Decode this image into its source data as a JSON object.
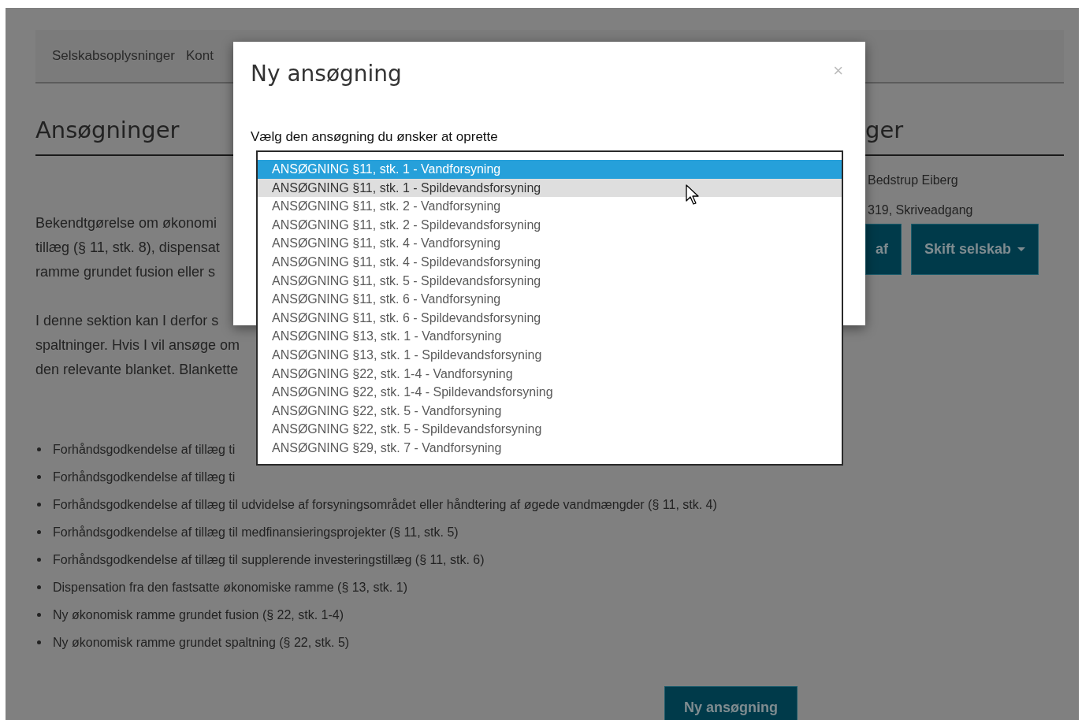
{
  "nav": {
    "items": [
      {
        "label": "Selskabsoplysninger"
      },
      {
        "label": "Kont"
      }
    ]
  },
  "main": {
    "heading": "Ansøgninger",
    "paragraphs": [
      [
        "Bekendtgørelse om økonomi",
        "tillæg (§ 11, stk. 8), dispensat",
        "ramme grundet fusion eller s"
      ],
      [
        "I denne sektion kan I derfor s",
        "spaltninger. Hvis I vil ansøge om",
        "den relevante blanket. Blankette"
      ]
    ],
    "bullets": [
      "Forhåndsgodkendelse af tillæg ti",
      "Forhåndsgodkendelse af tillæg ti",
      "Forhåndsgodkendelse af tillæg til udvidelse af forsyningsområdet eller håndtering af øgede vandmængder (§ 11, stk. 4)",
      "Forhåndsgodkendelse af tillæg til medfinansieringsprojekter (§ 11, stk. 5)",
      "Forhåndsgodkendelse af tillæg til supplerende investeringstillæg (§ 11, stk. 6)",
      "Dispensation fra den fastsatte økonomiske ramme (§ 13, stk. 1)",
      "Ny økonomisk ramme grundet fusion (§ 22, stk. 1-4)",
      "Ny økonomisk ramme grundet spaltning (§ 22, stk. 5)"
    ],
    "button": "Ny ansøgning"
  },
  "side": {
    "heading": "ger",
    "lines": [
      "Bedstrup Eiberg",
      "319, Skriveadgang"
    ],
    "buttons": [
      {
        "label": "af",
        "caret": false
      },
      {
        "label": "Skift selskab",
        "caret": true
      }
    ]
  },
  "modal": {
    "title": "Ny ansøgning",
    "close": "×",
    "label": "Vælg den ansøgning du ønsker at oprette",
    "options": [
      {
        "label": "ANSØGNING §11, stk. 1 - Vandforsyning",
        "selected": true,
        "hovered": false
      },
      {
        "label": "ANSØGNING §11, stk. 1 - Spildevandsforsyning",
        "selected": false,
        "hovered": true
      },
      {
        "label": "ANSØGNING §11, stk. 2 - Vandforsyning",
        "selected": false,
        "hovered": false
      },
      {
        "label": "ANSØGNING §11, stk. 2 - Spildevandsforsyning",
        "selected": false,
        "hovered": false
      },
      {
        "label": "ANSØGNING §11, stk. 4 - Vandforsyning",
        "selected": false,
        "hovered": false
      },
      {
        "label": "ANSØGNING §11, stk. 4 - Spildevandsforsyning",
        "selected": false,
        "hovered": false
      },
      {
        "label": "ANSØGNING §11, stk. 5 - Spildevandsforsyning",
        "selected": false,
        "hovered": false
      },
      {
        "label": "ANSØGNING §11, stk. 6 - Vandforsyning",
        "selected": false,
        "hovered": false
      },
      {
        "label": "ANSØGNING §11, stk. 6 - Spildevandsforsyning",
        "selected": false,
        "hovered": false
      },
      {
        "label": "ANSØGNING §13, stk. 1 - Vandforsyning",
        "selected": false,
        "hovered": false
      },
      {
        "label": "ANSØGNING §13, stk. 1 - Spildevandsforsyning",
        "selected": false,
        "hovered": false
      },
      {
        "label": "ANSØGNING §22, stk. 1-4 - Vandforsyning",
        "selected": false,
        "hovered": false
      },
      {
        "label": "ANSØGNING §22, stk. 1-4 - Spildevandsforsyning",
        "selected": false,
        "hovered": false
      },
      {
        "label": "ANSØGNING §22, stk. 5 - Vandforsyning",
        "selected": false,
        "hovered": false
      },
      {
        "label": "ANSØGNING §22, stk. 5 - Spildevandsforsyning",
        "selected": false,
        "hovered": false
      },
      {
        "label": "ANSØGNING §29, stk. 7 - Vandforsyning",
        "selected": false,
        "hovered": false
      }
    ]
  }
}
